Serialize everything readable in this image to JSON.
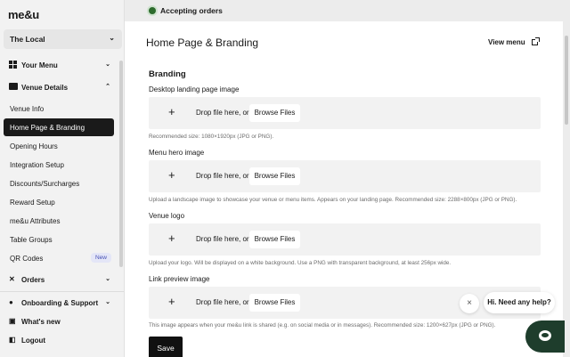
{
  "app": {
    "logo": "me&u"
  },
  "venue_selector": {
    "value": "The Local"
  },
  "sidebar": {
    "your_menu": "Your Menu",
    "venue_details": "Venue Details",
    "items": [
      {
        "label": "Venue Info",
        "active": false
      },
      {
        "label": "Home Page & Branding",
        "active": true
      },
      {
        "label": "Opening Hours",
        "active": false
      },
      {
        "label": "Integration Setup",
        "active": false
      },
      {
        "label": "Discounts/Surcharges",
        "active": false
      },
      {
        "label": "Reward Setup",
        "active": false
      },
      {
        "label": "me&u Attributes",
        "active": false
      },
      {
        "label": "Table Groups",
        "active": false
      },
      {
        "label": "QR Codes",
        "active": false,
        "badge": "New"
      }
    ],
    "orders": "Orders",
    "onboarding": "Onboarding & Support",
    "whats_new": "What's new",
    "logout": "Logout"
  },
  "status": {
    "text": "Accepting orders",
    "color": "#2d6b2d"
  },
  "main": {
    "title": "Home Page & Branding",
    "view_menu": "View menu",
    "section": "Branding",
    "drop_text": "Drop file here, or",
    "browse_label": "Browse Files",
    "fields": [
      {
        "label": "Desktop landing page image",
        "helper": "Recommended size: 1080×1920px (JPG or PNG)."
      },
      {
        "label": "Menu hero image",
        "helper": "Upload a landscape image to showcase your venue or menu items. Appears on your landing page. Recommended size: 2288×800px (JPG or PNG)."
      },
      {
        "label": "Venue logo",
        "helper": "Upload your logo. Will be displayed on a white background. Use a PNG with transparent background, at least 256px wide."
      },
      {
        "label": "Link preview image",
        "helper": "This image appears when your me&u link is shared (e.g. on social media or in messages). Recommended size: 1200×627px (JPG or PNG)."
      }
    ],
    "save_label": "Save"
  },
  "help": {
    "bubble": "Hi. Need any help?",
    "close": "×"
  }
}
